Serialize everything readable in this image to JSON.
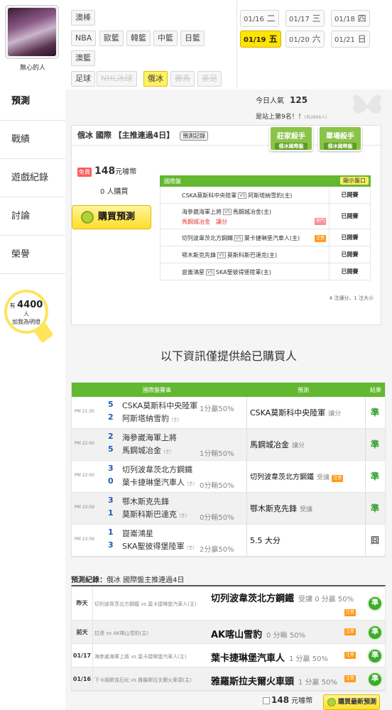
{
  "user": {
    "name": "無心的人"
  },
  "left_nav": [
    {
      "label": "預測"
    },
    {
      "label": "戰績"
    },
    {
      "label": "遊戲紀錄"
    },
    {
      "label": "討論"
    },
    {
      "label": "榮譽"
    }
  ],
  "bulb": {
    "prefix": "有",
    "count": "4400",
    "unit": "人",
    "text": "加我為明燈"
  },
  "sport_tags": [
    "澳棒",
    "NBA",
    "歐籃",
    "韓籃",
    "中籃",
    "日籃",
    "澳籃",
    "足球",
    "NHL冰球",
    "俄冰",
    "賽馬",
    "美足"
  ],
  "dates": [
    {
      "md": "01/16",
      "wd": "二"
    },
    {
      "md": "01/17",
      "wd": "三"
    },
    {
      "md": "01/18",
      "wd": "四"
    },
    {
      "md": "01/19",
      "wd": "五"
    },
    {
      "md": "01/20",
      "wd": "六"
    },
    {
      "md": "01/21",
      "wd": "日"
    }
  ],
  "stats": {
    "popularity_label": "今日人氣",
    "popularity_value": "125",
    "rank_text": "是站上第9名！！",
    "rank_total": "(共2866人)"
  },
  "card": {
    "title": "俄冰 國際 【主推連過4日】",
    "detail_btn": "預測記錄",
    "badges": [
      {
        "title": "莊家殺手",
        "sub": "俄冰國際盤"
      },
      {
        "title": "單場殺手",
        "sub": "俄冰國際盤"
      }
    ],
    "free_tag": "免費",
    "price": "148",
    "price_unit": "元噱幣",
    "buyers": "0 人購買",
    "buy_button": "購買預測",
    "table_header": "國際盤",
    "show_all": "顯示盤口",
    "rows": [
      {
        "home": "CSKA莫斯科中央陸軍",
        "away": "阿斯塔納雪豹(主)",
        "status": "已開賽"
      },
      {
        "home": "海參崴海軍上將",
        "away": "馬鋼城冶金(主)",
        "extra": "馬鋼城冶金　讓分",
        "icon": "熱門",
        "status": "已開賽"
      },
      {
        "home": "切列波韋茨北方鋼鐵",
        "away": "葉卡捷琳堡汽車人(主)",
        "icon": "注意",
        "status": "已開賽"
      },
      {
        "home": "鄂木斯克先鋒",
        "away": "莫斯科斯巴達克(主)",
        "status": "已開賽"
      },
      {
        "home": "崑崙鴻星",
        "away": "SKA聖彼得堡陸軍(主)",
        "status": "已開賽"
      }
    ],
    "vs": "VS",
    "note": "4 注讓分、1 注大小"
  },
  "banner": "以下資訊僅提供給已購買人",
  "pred_table": {
    "headers": {
      "match": "國際盤賽事",
      "pick": "預測",
      "result": "結果"
    },
    "rows": [
      {
        "time": "PM 21:30",
        "s1": "5",
        "t1": "CSKA莫斯科中央陸軍",
        "s2": "2",
        "t2": "阿斯塔納雪豹",
        "host": "(主)",
        "line": "1分贏50%",
        "pick": "CSKA莫斯科中央陸軍",
        "ptype": "讓分",
        "result": "準"
      },
      {
        "time": "PM 22:00",
        "s1": "2",
        "t1": "海參崴海軍上將",
        "s2": "5",
        "t2": "馬鋼城冶金",
        "host": "(主)",
        "line": "1分輸50%",
        "pick": "馬鋼城冶金",
        "ptype": "讓分",
        "result": "準"
      },
      {
        "time": "PM 22:00",
        "s1": "3",
        "t1": "切列波韋茨北方鋼鐵",
        "s2": "0",
        "t2": "葉卡捷琳堡汽車人",
        "host": "(主)",
        "line": "0分輸50%",
        "pick": "切列波韋茨北方鋼鐵",
        "ptype": "受讓",
        "icon": "注意",
        "result": "準"
      },
      {
        "time": "PM 23:59",
        "s1": "3",
        "t1": "鄂木斯克先鋒",
        "s2": "1",
        "t2": "莫斯科斯巴達克",
        "host": "(主)",
        "line": "0分輸50%",
        "pick": "鄂木斯克先鋒",
        "ptype": "受讓",
        "result": "準"
      },
      {
        "time": "PM 23:59",
        "s1": "1",
        "t1": "崑崙鴻星",
        "s2": "3",
        "t2": "SKA聖彼得堡陸軍",
        "host": "(主)",
        "line": "2分贏50%",
        "pick": "5.5 大分",
        "ptype": "",
        "result": "囧"
      }
    ]
  },
  "history": {
    "label": "預測紀錄：",
    "title": "俄冰 國際盤主推連過4日",
    "rows": [
      {
        "day": "昨天",
        "game": "切列波韋茨北方鋼鐵 vs 葉卡捷琳堡汽車人(主)",
        "pick": "切列波韋茨北方鋼鐵",
        "odds": "受讓 0 分贏 50%",
        "icon": "注意",
        "res": "準"
      },
      {
        "day": "前天",
        "game": "拉達 vs AK喀山雪豹(主)",
        "pick": "AK喀山雪豹",
        "odds": "0 分輸 50%",
        "icon": "注意",
        "res": "準"
      },
      {
        "day": "01/17",
        "game": "海參崴海軍上將 vs 葉卡捷琳堡汽車人(主)",
        "pick": "葉卡捷琳堡汽車人",
        "odds": "1 分贏 50%",
        "icon": "注意",
        "res": "準"
      },
      {
        "day": "01/16",
        "game": "下卡姆斯克石化 vs 雅羅斯拉夫爾火車頭(主)",
        "pick": "雅羅斯拉夫爾火車頭",
        "odds": "1 分贏 50%",
        "icon": "注意",
        "res": "準"
      }
    ]
  },
  "footer": {
    "price": "148",
    "unit": "元噱幣",
    "button": "購買最新預測"
  },
  "colors": {
    "accent_green": "#62b830",
    "highlight_yellow": "#ffe400",
    "win_green": "#2a9d2a"
  }
}
